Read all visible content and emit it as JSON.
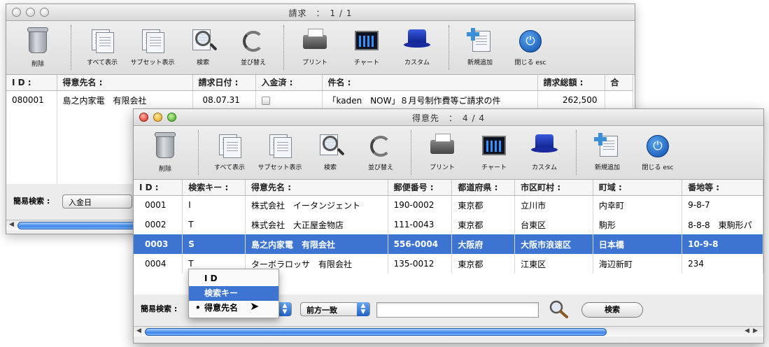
{
  "back_window": {
    "title": "請求　：　1 / 1",
    "toolbar": [
      "削除",
      "すべて表示",
      "サブセット表示",
      "検索",
      "並び替え",
      "プリント",
      "チャート",
      "カスタム",
      "新規追加",
      "閉じる esc"
    ],
    "columns": [
      "I D :",
      "得意先名 :",
      "請求日付 :",
      "入金済 :",
      "件名 :",
      "請求総額 :",
      "合"
    ],
    "rows": [
      {
        "id": "080001",
        "name": "島之内家電　有限会社",
        "date": "08.07.31",
        "subject": "「kaden　NOW」８月号制作費等ご請求の件",
        "amount": "262,500"
      }
    ],
    "search_label": "簡易検索 :",
    "search_field": "入金日"
  },
  "front_window": {
    "title": "得意先　：　4 / 4",
    "toolbar": [
      "削除",
      "すべて表示",
      "サブセット表示",
      "検索",
      "並び替え",
      "プリント",
      "チャート",
      "カスタム",
      "新規追加",
      "閉じる esc"
    ],
    "columns": [
      "I D :",
      "検索キー :",
      "得意先名 :",
      "郵便番号 :",
      "都道府県 :",
      "市区町村 :",
      "町域 :",
      "番地等 :"
    ],
    "rows": [
      [
        "0001",
        "I",
        "株式会社　イータンジェント",
        "190-0002",
        "東京都",
        "立川市",
        "内幸町",
        "9-8-7"
      ],
      [
        "0002",
        "T",
        "株式会社　大正屋金物店",
        "111-0043",
        "東京都",
        "台東区",
        "駒形",
        "8-8-8　東駒形パ"
      ],
      [
        "0003",
        "S",
        "島之内家電　有限会社",
        "556-0004",
        "大阪府",
        "大阪市浪速区",
        "日本橋",
        "10-9-8"
      ],
      [
        "0004",
        "T",
        "ターボラロッサ　有限会社",
        "135-0012",
        "東京都",
        "江東区",
        "海辺新町",
        "234"
      ]
    ],
    "selected_row": 2,
    "search_label": "簡易検索 :",
    "match_mode": "前方一致",
    "search_input_value": "",
    "search_button": "検索",
    "dropdown_menu": [
      "I D",
      "検索キー",
      "得意先名"
    ],
    "dropdown_highlighted": "検索キー",
    "dropdown_checked": "得意先名"
  },
  "colors": {
    "selection": "#3d74d1",
    "window_bg": "#ececec"
  }
}
